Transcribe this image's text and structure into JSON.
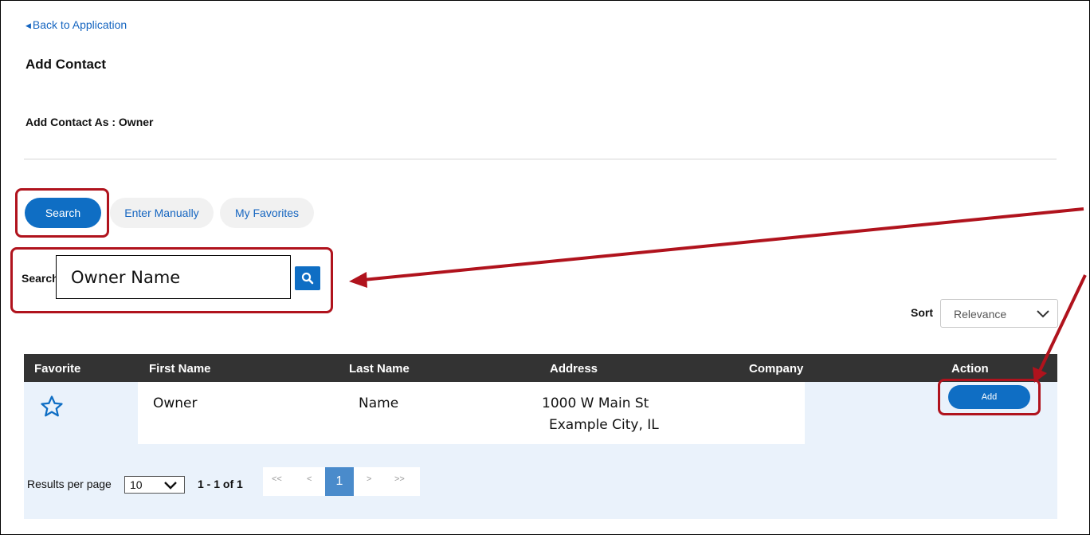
{
  "nav": {
    "back_label": "Back to Application"
  },
  "page": {
    "title": "Add Contact",
    "add_as": "Add Contact As  : Owner"
  },
  "tabs": [
    {
      "label": "Search",
      "active": true
    },
    {
      "label": "Enter Manually",
      "active": false
    },
    {
      "label": "My Favorites",
      "active": false
    }
  ],
  "search": {
    "label": "Search",
    "value": "Owner Name"
  },
  "sort": {
    "label": "Sort",
    "selected": "Relevance"
  },
  "table": {
    "headers": {
      "favorite": "Favorite",
      "first_name": "First Name",
      "last_name": "Last Name",
      "address": "Address",
      "company": "Company",
      "action": "Action"
    },
    "rows": [
      {
        "first_name": "Owner",
        "last_name": "Name",
        "address_line1": "1000 W Main St",
        "address_line2": "Example City, IL",
        "company": "",
        "action_label": "Add"
      }
    ]
  },
  "pagination": {
    "results_per_page_label": "Results per page",
    "results_per_page_value": "10",
    "range": "1 - 1 of 1",
    "first": "<<",
    "prev": "<",
    "current": "1",
    "next": ">",
    "last": ">>"
  },
  "colors": {
    "primary": "#0f6ec4",
    "link": "#1565c0",
    "highlight": "#b0131d",
    "header_bg": "#333333",
    "panel_bg": "#eaf2fb",
    "page_active": "#4a8bcb"
  }
}
